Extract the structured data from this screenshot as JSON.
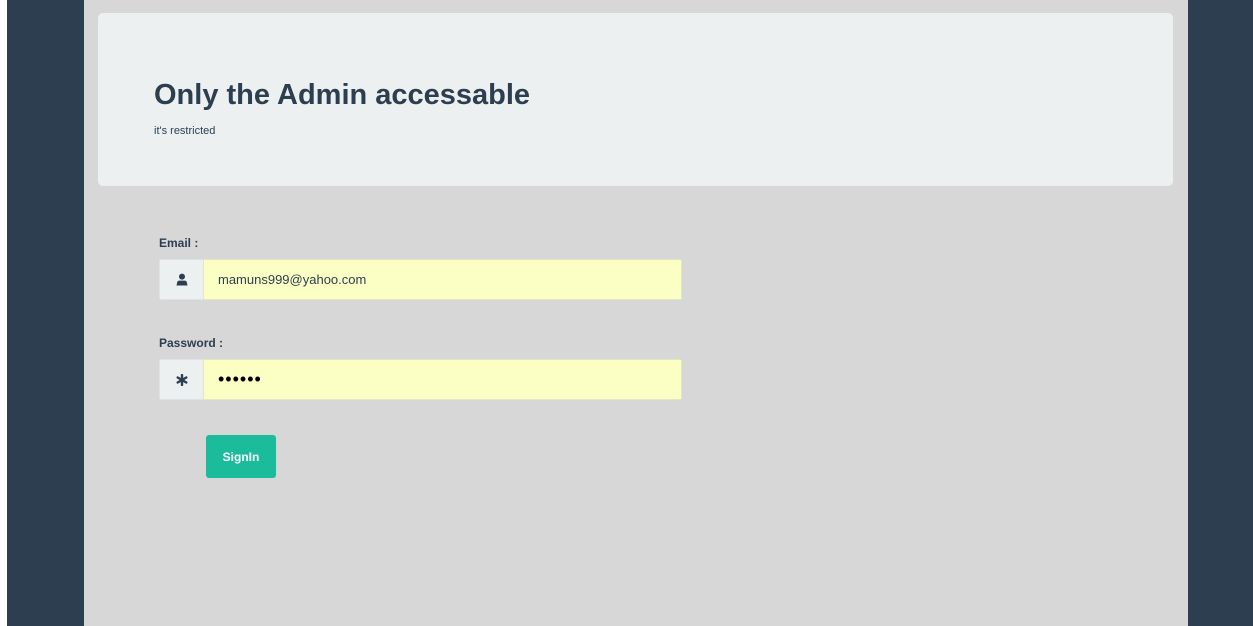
{
  "colors": {
    "frame": "#2c3e50",
    "content_bg": "#d7d7d7",
    "jumbotron_bg": "#ecf0f1",
    "text": "#2c3e50",
    "input_autofill_bg": "#fbffc4",
    "accent": "#1abc9c"
  },
  "header": {
    "title": "Only the Admin accessable",
    "subtitle": "it's restricted"
  },
  "form": {
    "email": {
      "label": "Email :",
      "icon": "user-icon",
      "value": "mamuns999@yahoo.com"
    },
    "password": {
      "label": "Password :",
      "icon": "asterisk-icon",
      "value": "••••••"
    },
    "submit_label": "SignIn"
  }
}
